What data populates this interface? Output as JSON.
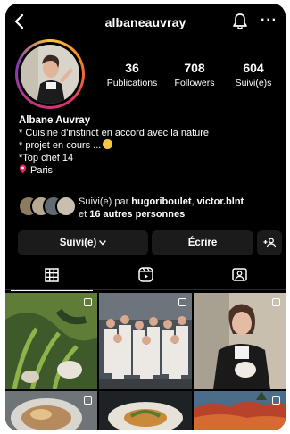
{
  "header": {
    "username": "albaneauvray",
    "back_icon": "chevron-left-icon",
    "notification_icon": "bell-icon",
    "more_label": "···"
  },
  "stats": [
    {
      "num": "36",
      "label": "Publications"
    },
    {
      "num": "708",
      "label": "Followers"
    },
    {
      "num": "604",
      "label": "Suivi(e)s"
    }
  ],
  "bio": {
    "name": "Albane Auvray",
    "line1": "* Cuisine d'instinct en accord avec la nature",
    "line2": "* projet en cours ...",
    "line3": "*Top chef 14",
    "location": "Paris"
  },
  "followed_by": {
    "prefix": "Suivi(e) par ",
    "user1": "hugoriboulet",
    "sep": ", ",
    "user2": "victor.blnt",
    "line2_prefix": "et ",
    "others": "16 autres personnes"
  },
  "actions": {
    "follow_label": "Suivi(e)",
    "write_label": "Écrire",
    "add_icon": "add-person-icon"
  },
  "tabs": [
    "grid-icon",
    "reels-icon",
    "tagged-icon"
  ],
  "colors": {
    "background": "#000000",
    "button": "#1b1b1b",
    "ring_gradient": [
      "#f9c33a",
      "#f77f1e",
      "#e1306c",
      "#c13584",
      "#833ab4"
    ]
  }
}
